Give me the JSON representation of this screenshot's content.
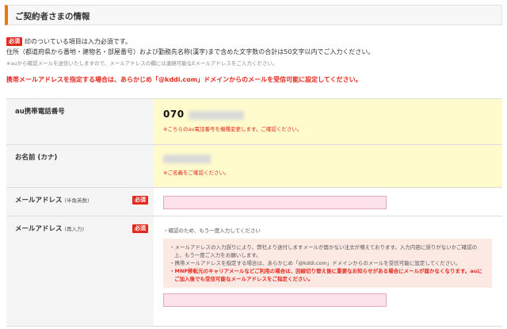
{
  "section": {
    "title": "ご契約者さまの情報"
  },
  "intro": {
    "required_badge": "必須",
    "required_text": "印のついている項目は入力必須です。",
    "address_rule": "住所（都道府県から番地・建物名・部屋番号）および勤務先名称(漢字)まで含めた文字数の合計は50文字以内でご入力ください。",
    "note": "※auから確認メールを送信いたしますので、メールアドレスの欄には連絡可能なEメールアドレスをご入力ください。",
    "warning": "携帯メールアドレスを指定する場合は、あらかじめ「@kddi.com」ドメインからのメールを受信可能に設定してください。"
  },
  "rows": {
    "phone": {
      "label": "au携帯電話番号",
      "value_prefix": "070",
      "note": "※こちらのau電話番号を機種変更します。ご確認ください。"
    },
    "name": {
      "label": "お名前 (カナ)",
      "note": "※ご名義をご確認ください。"
    },
    "email": {
      "label": "メールアドレス",
      "label_sub": "(半角英数)",
      "badge": "必須"
    },
    "email_confirm": {
      "label": "メールアドレス",
      "label_sub": "(再入力)",
      "badge": "必須",
      "hint": "・確認のため、もう一度入力してください",
      "notices": [
        "・メールアドレスの入力誤りにより、弊社より送付しますメールが届かない注文が増えております。入力内容に誤りがないかご確認の上、もう一度ご入力をお願いします。",
        "・携帯メールアドレスを指定する場合は、あらかじめ「@kddi.com」ドメインからのメールを受信可能に設定してください。"
      ],
      "red_notice": "・MNP移転元のキャリアメールなどご利用の場合は、回線切り替え後に重要なお知らせがある場合にメールが届かなくなります。auにご加入後でも受信可能なメールアドレスをご指定ください。"
    }
  },
  "colors": {
    "accent": "#ee7700",
    "required": "#e4291f",
    "highlight": "#fffbcc",
    "input_pink": "#fde2ec"
  }
}
